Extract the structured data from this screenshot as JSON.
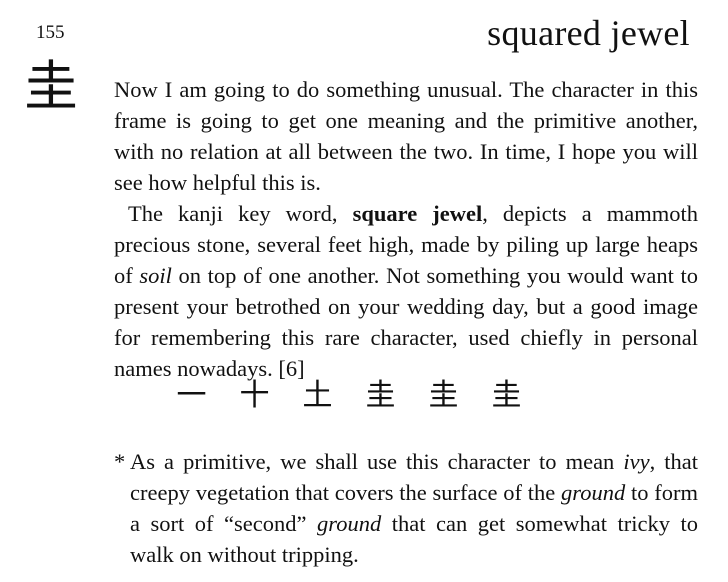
{
  "frame": {
    "number": "155",
    "key_word": "squared jewel",
    "kanji": "圭"
  },
  "body": {
    "p1": "Now I am going to do something unusual. The character in this frame is going to get one meaning and the primitive another, with no relation at all between the two. In time, I hope you will see how helpful this is.",
    "p2": {
      "t1": "The kanji key word, ",
      "bold": "square jewel",
      "t2": ", depicts a mammoth precious stone, several feet high, made by piling up large heaps of ",
      "italic": "soil",
      "t3": " on top of one another. Not something you would want to present your betrothed on your wedding day, but a good image for remembering this rare character, used chiefly in personal names nowadays. [6]"
    }
  },
  "stroke_order": [
    "一",
    "十",
    "土",
    "圭",
    "圭",
    "圭"
  ],
  "note": {
    "asterisk": "*",
    "t1": "As a primitive, we shall use this character to mean ",
    "i1": "ivy",
    "t2": ", that creepy vegetation that covers the surface of the ",
    "i2": "ground",
    "t3": " to form a sort of “second” ",
    "i3": "ground",
    "t4": " that can get somewhat tricky to walk on without tripping."
  }
}
